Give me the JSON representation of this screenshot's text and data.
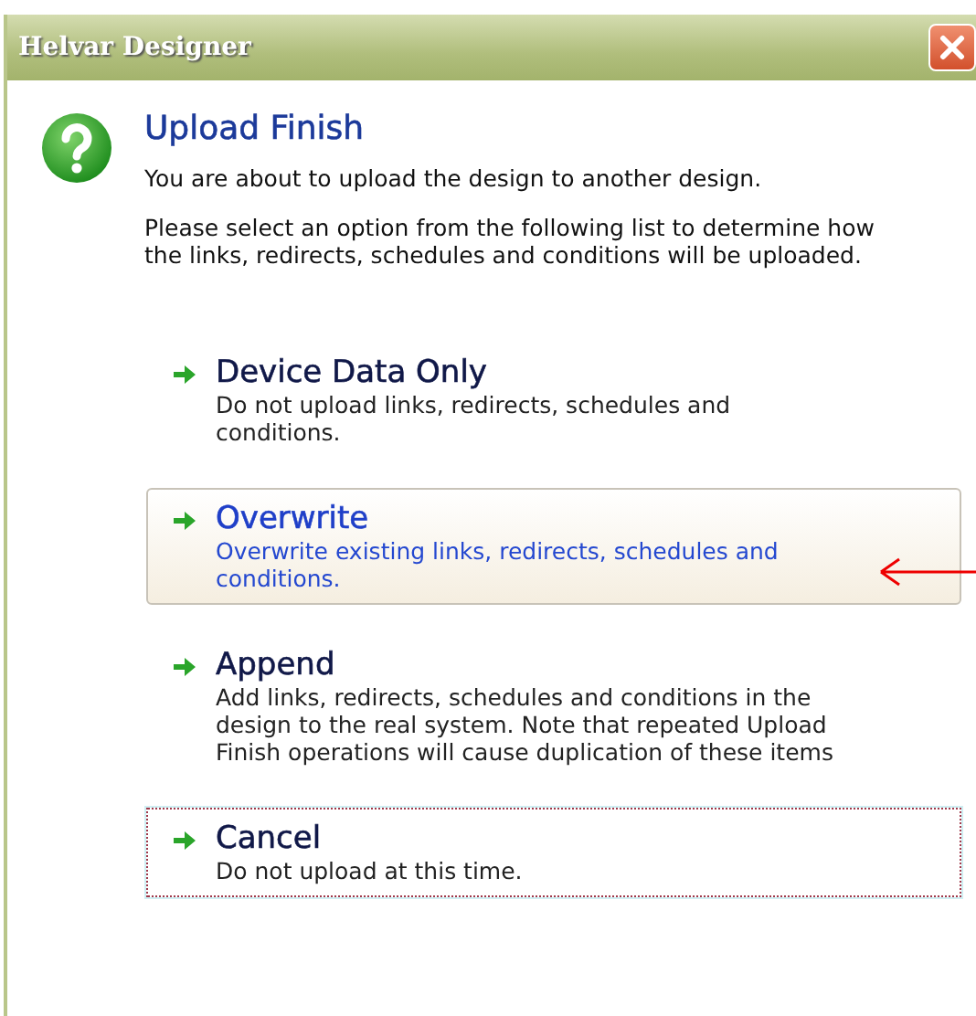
{
  "window": {
    "title": "Helvar Designer"
  },
  "heading": "Upload Finish",
  "paragraphs": [
    "You are about to upload the design to another design.",
    "Please select an option from the following list to determine how the links, redirects, schedules and conditions will be uploaded."
  ],
  "options": [
    {
      "title": "Device Data Only",
      "description": "Do not upload links, redirects, schedules and conditions.",
      "hovered": false,
      "focused": false,
      "pointed_at": false
    },
    {
      "title": "Overwrite",
      "description": "Overwrite existing links, redirects, schedules and conditions.",
      "hovered": true,
      "focused": false,
      "pointed_at": true
    },
    {
      "title": "Append",
      "description": "Add links, redirects, schedules and conditions in the design to the real system. Note that repeated Upload Finish operations will cause duplication of these items",
      "hovered": false,
      "focused": false,
      "pointed_at": false
    },
    {
      "title": "Cancel",
      "description": "Do not upload at this time.",
      "hovered": false,
      "focused": true,
      "pointed_at": false
    }
  ]
}
